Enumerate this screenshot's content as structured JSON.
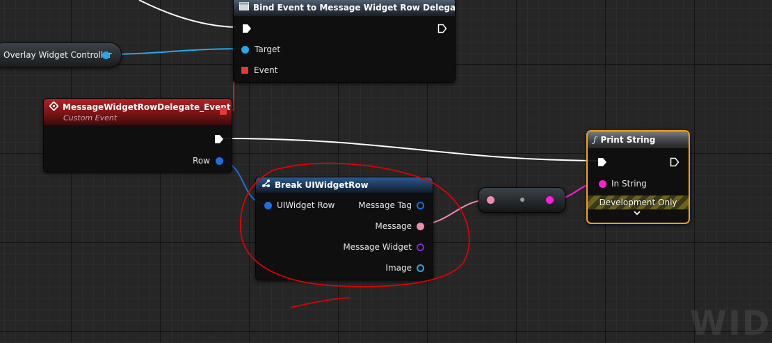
{
  "bind_node": {
    "title": "Bind Event to Message Widget Row Delegate",
    "pins": {
      "target": "Target",
      "event": "Event"
    }
  },
  "overlay_node": {
    "label": "Overlay Widget Controller"
  },
  "custom_event_node": {
    "title": "MessageWidgetRowDelegate_Event",
    "subtitle": "Custom Event",
    "pins": {
      "row": "Row"
    }
  },
  "break_node": {
    "title": "Break UIWidgetRow",
    "pins": {
      "input": "UIWidget Row",
      "message_tag": "Message Tag",
      "message": "Message",
      "message_widget": "Message Widget",
      "image": "Image"
    }
  },
  "print_node": {
    "title": "Print String",
    "pins": {
      "in_string": "In String"
    },
    "footer": "Development Only"
  },
  "watermark": "WIDG",
  "colors": {
    "exec": "#ffffff",
    "object_pin": "#27a7e6",
    "struct_pin": "#1d6ee0",
    "text_pin": "#f08ab0",
    "string_pin": "#ff1fd6",
    "widget_pin": "#7b2ad6",
    "event_pin": "#e23a3a",
    "print_outline": "#f0a020",
    "annotation": "#e00000"
  },
  "icons": {
    "bind": "function-square-icon",
    "event": "event-diamond-icon",
    "break": "break-struct-icon",
    "print": "function-f-icon"
  }
}
